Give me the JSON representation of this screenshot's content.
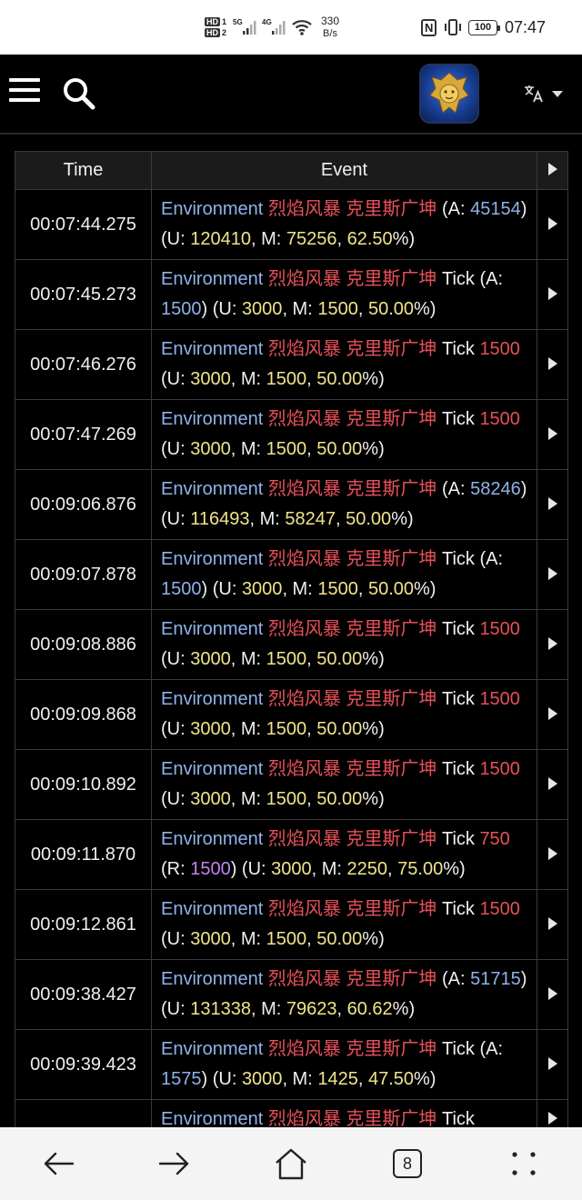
{
  "status_bar": {
    "hd1": "HD",
    "hd1_num": "1",
    "hd2": "HD",
    "hd2_num": "2",
    "net1": "5G",
    "net2": "4G",
    "speed_value": "330",
    "speed_unit": "B/s",
    "nfc": "N",
    "battery": "100",
    "time": "07:47"
  },
  "header": {
    "menu_icon": "hamburger-menu-icon",
    "search_icon": "search-icon",
    "logo_icon": "lion-crest-logo",
    "language_icon": "translate-icon",
    "dropdown_icon": "caret-down-icon"
  },
  "table": {
    "columns": [
      "Time",
      "Event"
    ],
    "rows": [
      {
        "time": "00:07:44.275",
        "event": [
          [
            "src",
            "Environment"
          ],
          [
            "w",
            " "
          ],
          [
            "spell",
            "烈焰风暴"
          ],
          [
            "w",
            " "
          ],
          [
            "spell",
            "克里斯广坤"
          ],
          [
            "w",
            " (A: "
          ],
          [
            "abs",
            "45154"
          ],
          [
            "w",
            ") (U: "
          ],
          [
            "num",
            "120410"
          ],
          [
            "w",
            ", M: "
          ],
          [
            "num",
            "75256"
          ],
          [
            "w",
            ", "
          ],
          [
            "num",
            "62.50"
          ],
          [
            "w",
            "%)"
          ]
        ]
      },
      {
        "time": "00:07:45.273",
        "event": [
          [
            "src",
            "Environment"
          ],
          [
            "w",
            " "
          ],
          [
            "spell",
            "烈焰风暴"
          ],
          [
            "w",
            " "
          ],
          [
            "spell",
            "克里斯广坤"
          ],
          [
            "w",
            " Tick (A: "
          ],
          [
            "abs",
            "1500"
          ],
          [
            "w",
            ") (U: "
          ],
          [
            "num",
            "3000"
          ],
          [
            "w",
            ", M: "
          ],
          [
            "num",
            "1500"
          ],
          [
            "w",
            ", "
          ],
          [
            "num",
            "50.00"
          ],
          [
            "w",
            "%)"
          ]
        ]
      },
      {
        "time": "00:07:46.276",
        "event": [
          [
            "src",
            "Environment"
          ],
          [
            "w",
            " "
          ],
          [
            "spell",
            "烈焰风暴"
          ],
          [
            "w",
            " "
          ],
          [
            "spell",
            "克里斯广坤"
          ],
          [
            "w",
            " Tick "
          ],
          [
            "amt",
            "1500"
          ],
          [
            "w",
            " (U: "
          ],
          [
            "num",
            "3000"
          ],
          [
            "w",
            ", M: "
          ],
          [
            "num",
            "1500"
          ],
          [
            "w",
            ", "
          ],
          [
            "num",
            "50.00"
          ],
          [
            "w",
            "%)"
          ]
        ]
      },
      {
        "time": "00:07:47.269",
        "event": [
          [
            "src",
            "Environment"
          ],
          [
            "w",
            " "
          ],
          [
            "spell",
            "烈焰风暴"
          ],
          [
            "w",
            " "
          ],
          [
            "spell",
            "克里斯广坤"
          ],
          [
            "w",
            " Tick "
          ],
          [
            "amt",
            "1500"
          ],
          [
            "w",
            " (U: "
          ],
          [
            "num",
            "3000"
          ],
          [
            "w",
            ", M: "
          ],
          [
            "num",
            "1500"
          ],
          [
            "w",
            ", "
          ],
          [
            "num",
            "50.00"
          ],
          [
            "w",
            "%)"
          ]
        ]
      },
      {
        "time": "00:09:06.876",
        "event": [
          [
            "src",
            "Environment"
          ],
          [
            "w",
            " "
          ],
          [
            "spell",
            "烈焰风暴"
          ],
          [
            "w",
            " "
          ],
          [
            "spell",
            "克里斯广坤"
          ],
          [
            "w",
            " (A: "
          ],
          [
            "abs",
            "58246"
          ],
          [
            "w",
            ") (U: "
          ],
          [
            "num",
            "116493"
          ],
          [
            "w",
            ", M: "
          ],
          [
            "num",
            "58247"
          ],
          [
            "w",
            ", "
          ],
          [
            "num",
            "50.00"
          ],
          [
            "w",
            "%)"
          ]
        ]
      },
      {
        "time": "00:09:07.878",
        "event": [
          [
            "src",
            "Environment"
          ],
          [
            "w",
            " "
          ],
          [
            "spell",
            "烈焰风暴"
          ],
          [
            "w",
            " "
          ],
          [
            "spell",
            "克里斯广坤"
          ],
          [
            "w",
            " Tick (A: "
          ],
          [
            "abs",
            "1500"
          ],
          [
            "w",
            ") (U: "
          ],
          [
            "num",
            "3000"
          ],
          [
            "w",
            ", M: "
          ],
          [
            "num",
            "1500"
          ],
          [
            "w",
            ", "
          ],
          [
            "num",
            "50.00"
          ],
          [
            "w",
            "%)"
          ]
        ]
      },
      {
        "time": "00:09:08.886",
        "event": [
          [
            "src",
            "Environment"
          ],
          [
            "w",
            " "
          ],
          [
            "spell",
            "烈焰风暴"
          ],
          [
            "w",
            " "
          ],
          [
            "spell",
            "克里斯广坤"
          ],
          [
            "w",
            " Tick "
          ],
          [
            "amt",
            "1500"
          ],
          [
            "w",
            " (U: "
          ],
          [
            "num",
            "3000"
          ],
          [
            "w",
            ", M: "
          ],
          [
            "num",
            "1500"
          ],
          [
            "w",
            ", "
          ],
          [
            "num",
            "50.00"
          ],
          [
            "w",
            "%)"
          ]
        ]
      },
      {
        "time": "00:09:09.868",
        "event": [
          [
            "src",
            "Environment"
          ],
          [
            "w",
            " "
          ],
          [
            "spell",
            "烈焰风暴"
          ],
          [
            "w",
            " "
          ],
          [
            "spell",
            "克里斯广坤"
          ],
          [
            "w",
            " Tick "
          ],
          [
            "amt",
            "1500"
          ],
          [
            "w",
            " (U: "
          ],
          [
            "num",
            "3000"
          ],
          [
            "w",
            ", M: "
          ],
          [
            "num",
            "1500"
          ],
          [
            "w",
            ", "
          ],
          [
            "num",
            "50.00"
          ],
          [
            "w",
            "%)"
          ]
        ]
      },
      {
        "time": "00:09:10.892",
        "event": [
          [
            "src",
            "Environment"
          ],
          [
            "w",
            " "
          ],
          [
            "spell",
            "烈焰风暴"
          ],
          [
            "w",
            " "
          ],
          [
            "spell",
            "克里斯广坤"
          ],
          [
            "w",
            " Tick "
          ],
          [
            "amt",
            "1500"
          ],
          [
            "w",
            " (U: "
          ],
          [
            "num",
            "3000"
          ],
          [
            "w",
            ", M: "
          ],
          [
            "num",
            "1500"
          ],
          [
            "w",
            ", "
          ],
          [
            "num",
            "50.00"
          ],
          [
            "w",
            "%)"
          ]
        ]
      },
      {
        "time": "00:09:11.870",
        "event": [
          [
            "src",
            "Environment"
          ],
          [
            "w",
            " "
          ],
          [
            "spell",
            "烈焰风暴"
          ],
          [
            "w",
            " "
          ],
          [
            "spell",
            "克里斯广坤"
          ],
          [
            "w",
            " Tick "
          ],
          [
            "amt",
            "750"
          ],
          [
            "w",
            " (R: "
          ],
          [
            "res",
            "1500"
          ],
          [
            "w",
            ") (U: "
          ],
          [
            "num",
            "3000"
          ],
          [
            "w",
            ", M: "
          ],
          [
            "num",
            "2250"
          ],
          [
            "w",
            ", "
          ],
          [
            "num",
            "75.00"
          ],
          [
            "w",
            "%)"
          ]
        ]
      },
      {
        "time": "00:09:12.861",
        "event": [
          [
            "src",
            "Environment"
          ],
          [
            "w",
            " "
          ],
          [
            "spell",
            "烈焰风暴"
          ],
          [
            "w",
            " "
          ],
          [
            "spell",
            "克里斯广坤"
          ],
          [
            "w",
            " Tick "
          ],
          [
            "amt",
            "1500"
          ],
          [
            "w",
            " (U: "
          ],
          [
            "num",
            "3000"
          ],
          [
            "w",
            ", M: "
          ],
          [
            "num",
            "1500"
          ],
          [
            "w",
            ", "
          ],
          [
            "num",
            "50.00"
          ],
          [
            "w",
            "%)"
          ]
        ]
      },
      {
        "time": "00:09:38.427",
        "event": [
          [
            "src",
            "Environment"
          ],
          [
            "w",
            " "
          ],
          [
            "spell",
            "烈焰风暴"
          ],
          [
            "w",
            " "
          ],
          [
            "spell",
            "克里斯广坤"
          ],
          [
            "w",
            " (A: "
          ],
          [
            "abs",
            "51715"
          ],
          [
            "w",
            ") (U: "
          ],
          [
            "num",
            "131338"
          ],
          [
            "w",
            ", M: "
          ],
          [
            "num",
            "79623"
          ],
          [
            "w",
            ", "
          ],
          [
            "num",
            "60.62"
          ],
          [
            "w",
            "%)"
          ]
        ]
      },
      {
        "time": "00:09:39.423",
        "event": [
          [
            "src",
            "Environment"
          ],
          [
            "w",
            " "
          ],
          [
            "spell",
            "烈焰风暴"
          ],
          [
            "w",
            " "
          ],
          [
            "spell",
            "克里斯广坤"
          ],
          [
            "w",
            " Tick (A: "
          ],
          [
            "abs",
            "1575"
          ],
          [
            "w",
            ") (U: "
          ],
          [
            "num",
            "3000"
          ],
          [
            "w",
            ", M: "
          ],
          [
            "num",
            "1425"
          ],
          [
            "w",
            ", "
          ],
          [
            "num",
            "47.50"
          ],
          [
            "w",
            "%)"
          ]
        ]
      },
      {
        "time": "",
        "event": [
          [
            "src",
            "Environment"
          ],
          [
            "w",
            " "
          ],
          [
            "spell",
            "烈焰风暴"
          ],
          [
            "w",
            " "
          ],
          [
            "spell",
            "克里斯广坤"
          ],
          [
            "w",
            " Tick"
          ]
        ]
      }
    ]
  },
  "bottom_nav": {
    "back_icon": "back-arrow-icon",
    "forward_icon": "forward-arrow-icon",
    "home_icon": "home-icon",
    "tabs_count": "8",
    "more_icon": "more-dots-icon"
  },
  "colors": {
    "source": "#8fb2ea",
    "spell": "#e8505a",
    "number": "#f1e48a",
    "resisted": "#c284f0",
    "absorbed": "#8fb2ea"
  }
}
